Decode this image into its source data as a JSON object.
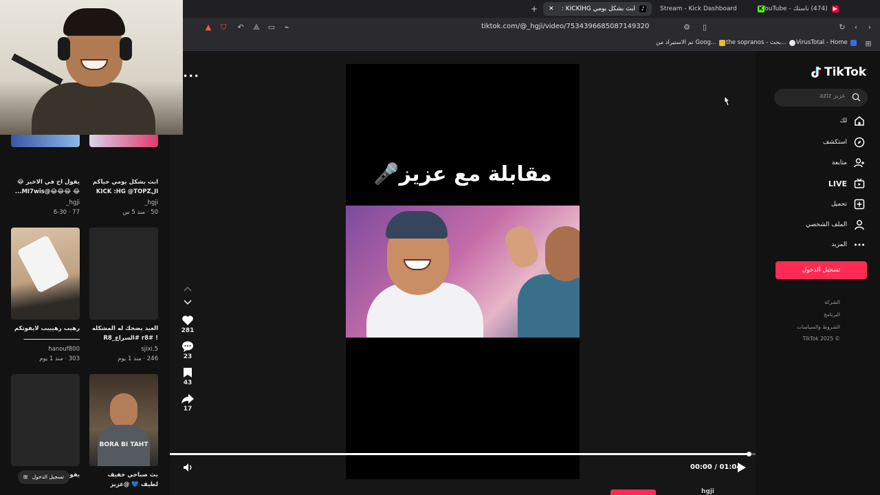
{
  "browser": {
    "tabs": [
      {
        "label": "ابث بشكل يومي HGاKICK :",
        "active": true
      },
      {
        "label": "Stream - Kick Dashboard",
        "active": false
      },
      {
        "label": "",
        "active": false,
        "icon": "kick-icon"
      },
      {
        "label": "(474) ناستك - YouTube",
        "active": false
      }
    ],
    "new_tab": "+",
    "close_tab": "✕",
    "url": "tiktok.com/@_hgji/video/7534396685087149320",
    "bookmarks": [
      {
        "label": "VirusTotal - Home",
        "color": "#3b6fd6"
      },
      {
        "label": "the sopranos - بحث...",
        "color": "#e8e8e8"
      },
      {
        "label": "تم الاستيراد من Goog...",
        "color": "#e6b93c"
      }
    ]
  },
  "left_grid": {
    "cards": [
      {
        "title": "ابث بشكل يومي حياكم الKICK :HG @TOPZ ...",
        "author": "hgji_",
        "meta": "50 · منذ 5 س"
      },
      {
        "title": "يقول اخ في الاخير 😂😂 😂😂😂@MI7wis...",
        "author": "hgji_",
        "meta": "77 · 6-30"
      },
      {
        "title": "العيد يضحك له المشكله ! #r8 #السراع_R8",
        "author": "sjixi.5",
        "meta": "246 · منذ 1 يوم"
      },
      {
        "title": "رهيب رهيييب لايفوتكم ــــــــــــــــــــــــــــ",
        "author": "hanouf800",
        "meta": "303 · منذ 1 يوم"
      },
      {
        "title": "بث صباحي خفيف لطيف 💙 @عزيز المحمد | Aziz...",
        "author": "",
        "meta": ""
      },
      {
        "title": "يفوز بتو... رعب...",
        "author": "",
        "meta": ""
      }
    ],
    "thumb_text": "BORA BI TAHT",
    "login_pill": "تسجيل الدخول"
  },
  "video": {
    "title": "مقابلة مع عزيز🎤",
    "time": "00:00 / 01:04",
    "progress": 0.99,
    "more": "•••"
  },
  "actions": {
    "likes": "281",
    "comments": "23",
    "saves": "43",
    "shares": "17"
  },
  "sidebar": {
    "logo": "TikTok",
    "search_placeholder": "عزيز aziz",
    "nav": [
      {
        "label": "لك",
        "icon": "home-icon"
      },
      {
        "label": "استكشف",
        "icon": "compass-icon"
      },
      {
        "label": "متابعة",
        "icon": "following-icon"
      },
      {
        "label": "LIVE",
        "icon": "live-tv-icon"
      },
      {
        "label": "تحميل",
        "icon": "upload-icon"
      },
      {
        "label": "الملف الشخصي",
        "icon": "profile-icon"
      },
      {
        "label": "المزيد",
        "icon": "more-icon"
      }
    ],
    "login_button": "تسجيل الدخول",
    "footer": [
      "الشركة",
      "البرنامج",
      "الشروط والسياسات",
      "© 2025 TikTok"
    ]
  },
  "bottom": {
    "text": "hgji"
  },
  "colors": {
    "accent": "#fe2c55",
    "background": "#121212",
    "player": "#000000"
  }
}
